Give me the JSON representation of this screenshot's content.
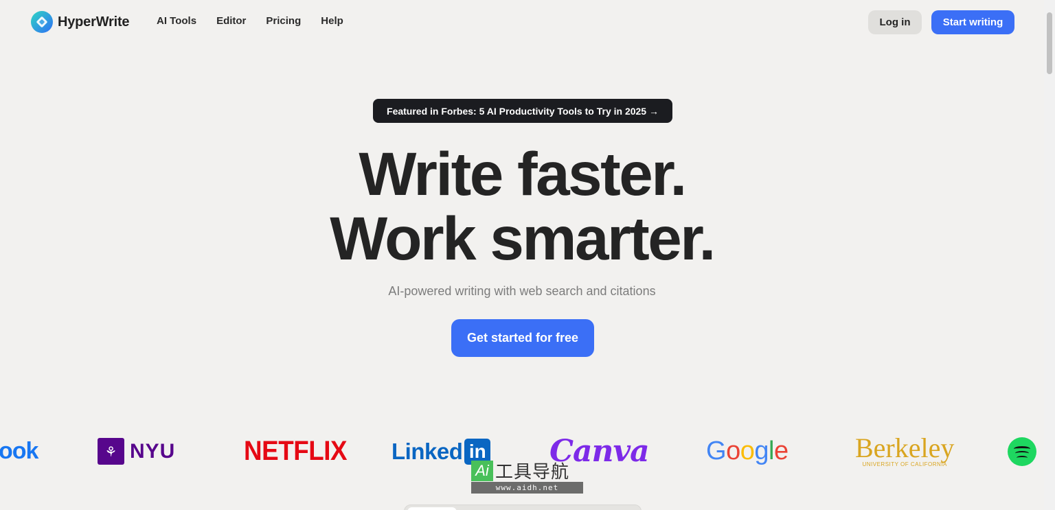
{
  "brand": {
    "name": "HyperWrite",
    "logo_icon": "hyperwrite-logo-icon"
  },
  "nav": {
    "items": [
      "AI Tools",
      "Editor",
      "Pricing",
      "Help"
    ],
    "login_label": "Log in",
    "start_label": "Start writing"
  },
  "hero": {
    "announcement": "Featured in Forbes: 5 AI Productivity Tools to Try in 2025 →",
    "headline_line1": "Write faster.",
    "headline_line2": "Work smarter.",
    "subtitle": "AI-powered writing with web search and citations",
    "cta_label": "Get started for free"
  },
  "logos": {
    "facebook": "ook",
    "nyu": "NYU",
    "netflix": "NETFLIX",
    "linkedin_text": "Linked",
    "linkedin_box": "in",
    "canva": "Canva",
    "google": "Google",
    "berkeley": "Berkeley",
    "berkeley_sub": "UNIVERSITY OF CALIFORNIA"
  },
  "watermark": {
    "ai": "Ai",
    "text": "工具导航",
    "url": "www.aidh.net"
  },
  "colors": {
    "background": "#f2f1ef",
    "accent": "#3b6ff6",
    "announcement_bg": "#1b1c20",
    "headline": "#242424"
  }
}
